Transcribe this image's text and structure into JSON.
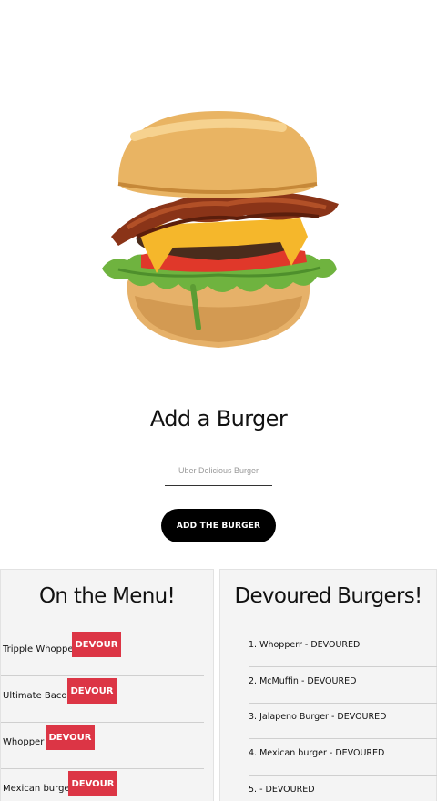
{
  "hero": {
    "image": "burger-image"
  },
  "form": {
    "title": "Add a Burger",
    "placeholder": "Uber Delicious Burger",
    "button_label": "ADD THE BURGER"
  },
  "menu": {
    "title": "On the Menu!",
    "items": [
      {
        "name": "Tripple Whopper",
        "button": "DEVOUR"
      },
      {
        "name": "Ultimate Bacon",
        "button": "DEVOUR"
      },
      {
        "name": "Whopper",
        "button": "DEVOUR"
      },
      {
        "name": "Mexican burger",
        "button": "DEVOUR"
      }
    ]
  },
  "devoured": {
    "title": "Devoured Burgers!",
    "items": [
      "1. Whopperr - DEVOURED",
      "2. McMuffin - DEVOURED",
      "3. Jalapeno Burger - DEVOURED",
      "4. Mexican burger - DEVOURED",
      "5. - DEVOURED"
    ]
  },
  "colors": {
    "devour_button": "#dc3545",
    "add_button": "#000000",
    "panel_bg": "#f4f4f4"
  }
}
